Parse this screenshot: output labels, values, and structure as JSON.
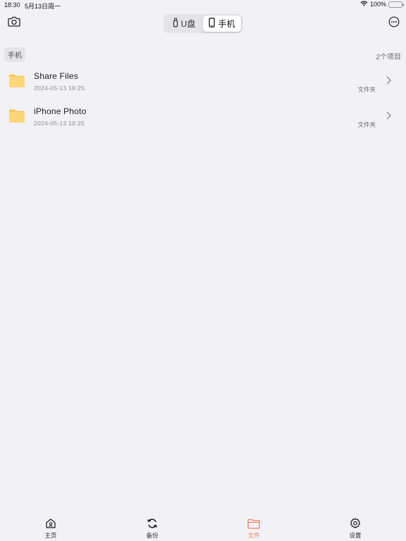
{
  "status_bar": {
    "time": "18:30",
    "date": "5月13日周一",
    "battery": "100%"
  },
  "toolbar": {
    "segments": [
      {
        "label": "U盘",
        "active": false
      },
      {
        "label": "手机",
        "active": true
      }
    ]
  },
  "section": {
    "title": "手机",
    "count": "2个项目"
  },
  "files": [
    {
      "name": "Share Files",
      "modified": "2024-05-13 18:25",
      "kind": "文件夹"
    },
    {
      "name": "iPhone Photo",
      "modified": "2024-05-13 18:25",
      "kind": "文件夹"
    }
  ],
  "tab_bar": {
    "items": [
      {
        "label": "主页",
        "icon": "home-icon",
        "active": false
      },
      {
        "label": "备份",
        "icon": "sync-icon",
        "active": false
      },
      {
        "label": "文件",
        "icon": "folder-icon",
        "active": true
      },
      {
        "label": "设置",
        "icon": "gear-icon",
        "active": false
      }
    ]
  },
  "colors": {
    "accent": "#f08467",
    "folder": "#fcd77a",
    "background": "#f2f1f6",
    "battery": "#34c759"
  }
}
